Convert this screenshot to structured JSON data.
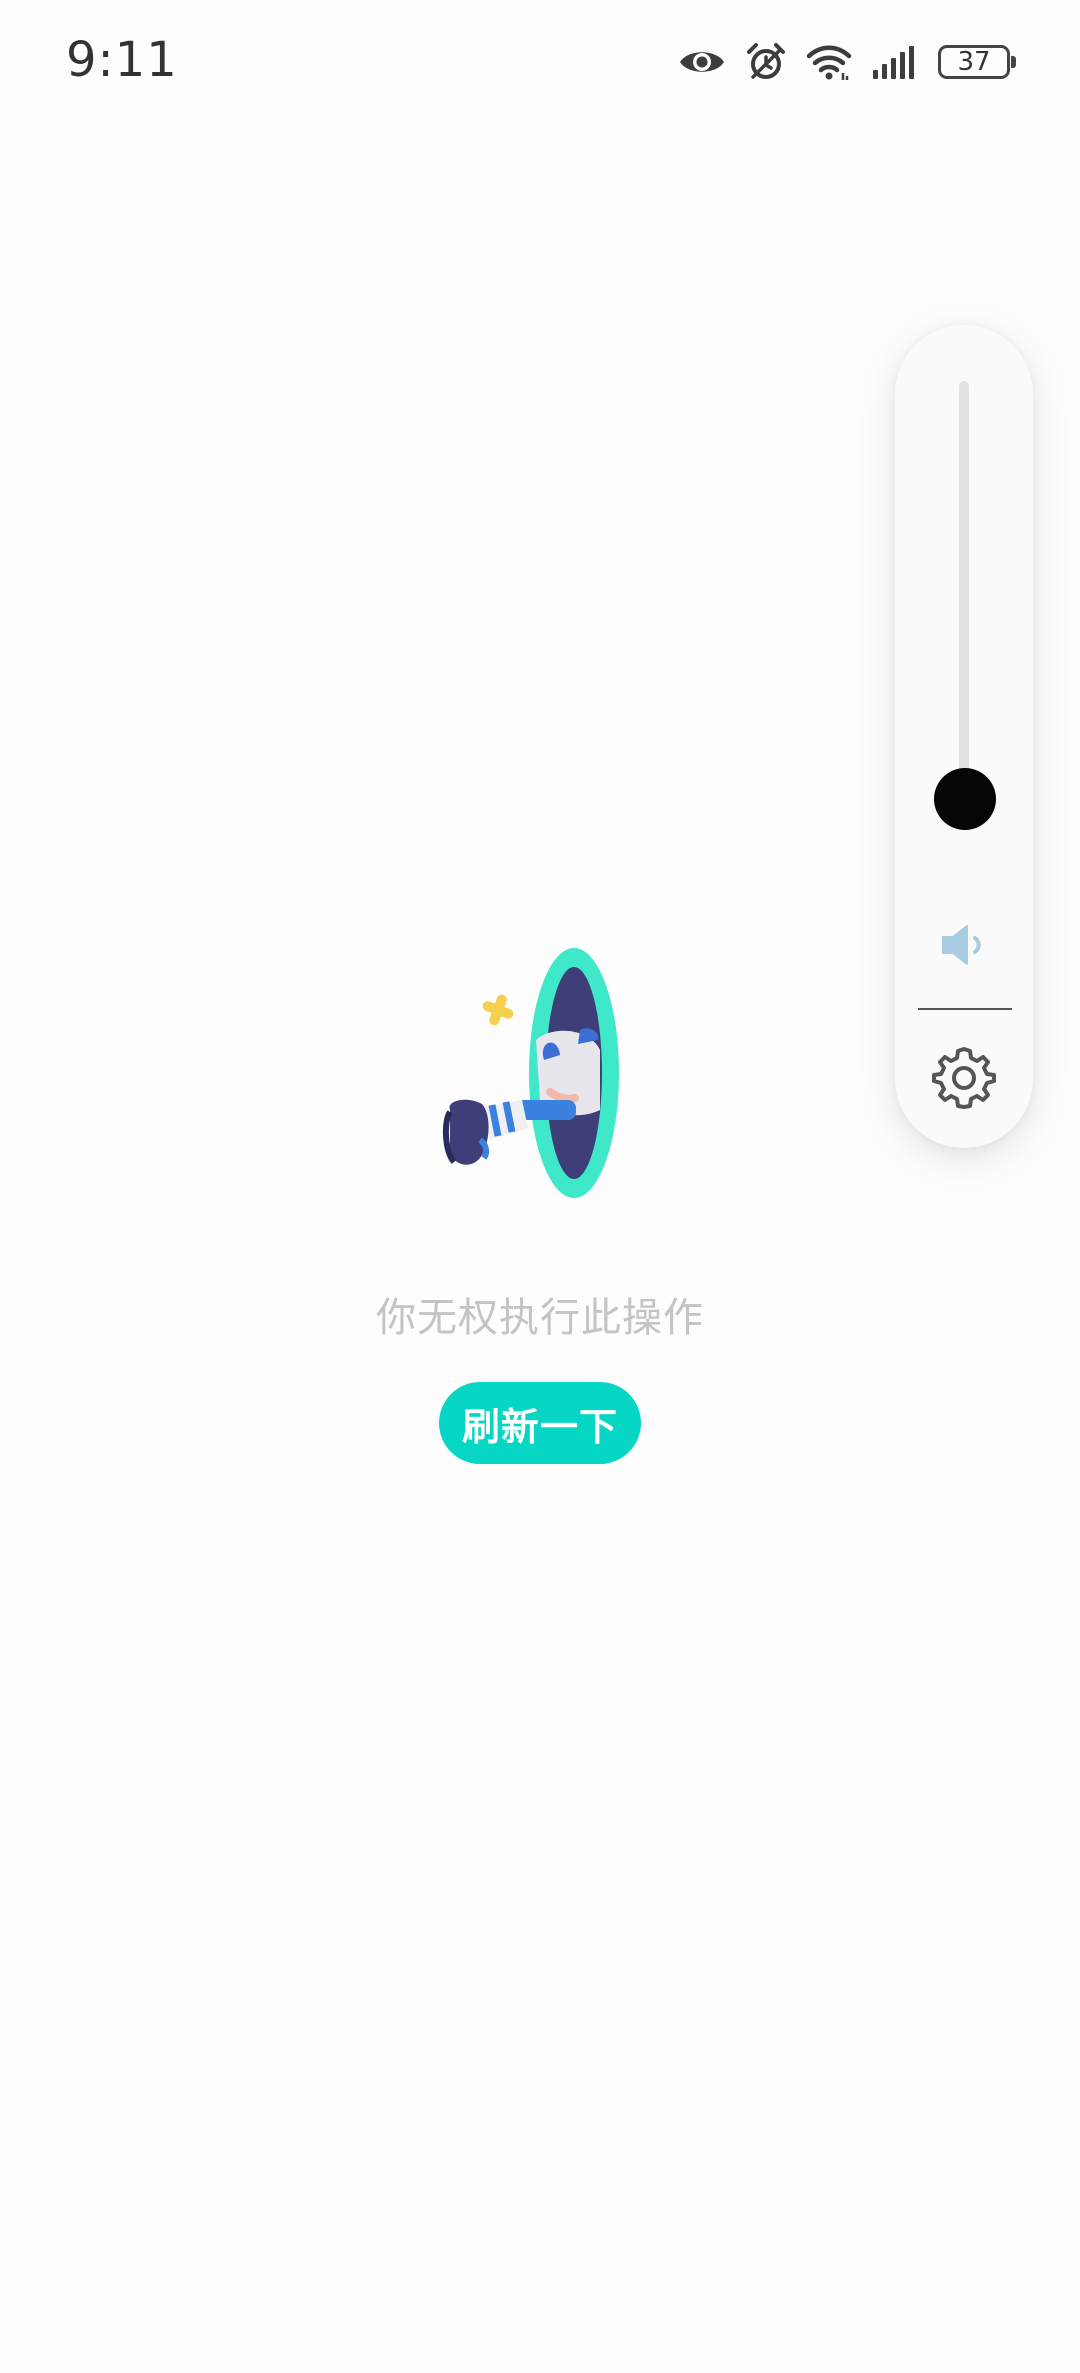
{
  "status_bar": {
    "time": "9:11",
    "battery_level": "37",
    "icons": [
      "eye-icon",
      "alarm-icon",
      "wifi-icon",
      "signal-icon",
      "battery-icon"
    ]
  },
  "volume_panel": {
    "level": 0.05,
    "speaker_icon": "speaker-icon",
    "settings_icon": "gear-icon"
  },
  "main": {
    "illustration": "portal-illustration",
    "message": "你无权执行此操作",
    "refresh_button_label": "刷新一下"
  },
  "colors": {
    "accent": "#06d6c4",
    "message_text": "#c3c3c8",
    "portal_ring": "#3fe8c8",
    "portal_inner": "#3e3f78",
    "sparkle": "#f4d04c"
  }
}
